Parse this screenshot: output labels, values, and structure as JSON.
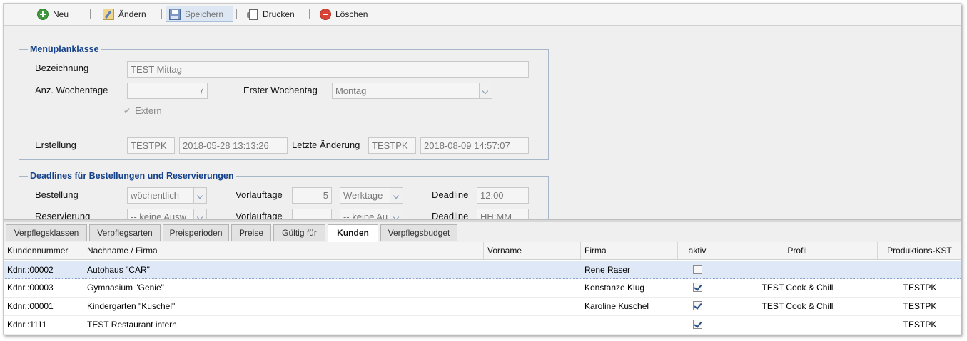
{
  "toolbar": {
    "new_label": "Neu",
    "edit_label": "Ändern",
    "save_label": "Speichern",
    "print_label": "Drucken",
    "delete_label": "Löschen"
  },
  "menuplan": {
    "legend": "Menüplanklasse",
    "bezeichnung_label": "Bezeichnung",
    "bezeichnung_value": "TEST Mittag",
    "wochentage_label": "Anz. Wochentage",
    "wochentage_value": "7",
    "erster_label": "Erster Wochentag",
    "erster_value": "Montag",
    "extern_label": "Extern",
    "extern_checked": true,
    "erstellung_label": "Erstellung",
    "erstellung_user": "TESTPK",
    "erstellung_date": "2018-05-28 13:13:26",
    "aenderung_label": "Letzte Änderung",
    "aenderung_user": "TESTPK",
    "aenderung_date": "2018-08-09 14:57:07"
  },
  "deadlines": {
    "legend": "Deadlines für Bestellungen und Reservierungen",
    "rows": [
      {
        "label": "Bestellung",
        "interval": "wöchentlich",
        "vorlauf_label": "Vorlauftage",
        "vorlauf_value": "5",
        "unit": "Werktage",
        "deadline_label": "Deadline",
        "deadline_value": "12:00"
      },
      {
        "label": "Reservierung",
        "interval": "-- keine Ausw.",
        "vorlauf_label": "Vorlauftage",
        "vorlauf_value": "",
        "unit": "-- keine Au",
        "deadline_label": "Deadline",
        "deadline_value": "HH:MM"
      }
    ]
  },
  "tabs": [
    {
      "label": "Verpflegsklassen"
    },
    {
      "label": "Verpflegsarten"
    },
    {
      "label": "Preisperioden"
    },
    {
      "label": "Preise"
    },
    {
      "label": "Gültig für"
    },
    {
      "label": "Kunden"
    },
    {
      "label": "Verpflegsbudget"
    }
  ],
  "active_tab": "Kunden",
  "grid": {
    "columns": [
      "Kundennummer",
      "Nachname / Firma",
      "Vorname",
      "Firma",
      "aktiv",
      "Profil",
      "Produktions-KST"
    ],
    "rows": [
      {
        "kundennummer": "Kdnr.:00002",
        "nachname": "Autohaus \"CAR\"",
        "vorname": "",
        "firma": "Rene Raser",
        "aktiv": false,
        "profil": "",
        "kst": ""
      },
      {
        "kundennummer": "Kdnr.:00003",
        "nachname": "Gymnasium \"Genie\"",
        "vorname": "",
        "firma": "Konstanze Klug",
        "aktiv": true,
        "profil": "TEST Cook & Chill",
        "kst": "TESTPK"
      },
      {
        "kundennummer": "Kdnr.:00001",
        "nachname": "Kindergarten \"Kuschel\"",
        "vorname": "",
        "firma": "Karoline Kuschel",
        "aktiv": true,
        "profil": "TEST Cook & Chill",
        "kst": "TESTPK"
      },
      {
        "kundennummer": "Kdnr.:1111",
        "nachname": "TEST Restaurant intern",
        "vorname": "",
        "firma": "",
        "aktiv": true,
        "profil": "",
        "kst": "TESTPK"
      }
    ]
  }
}
